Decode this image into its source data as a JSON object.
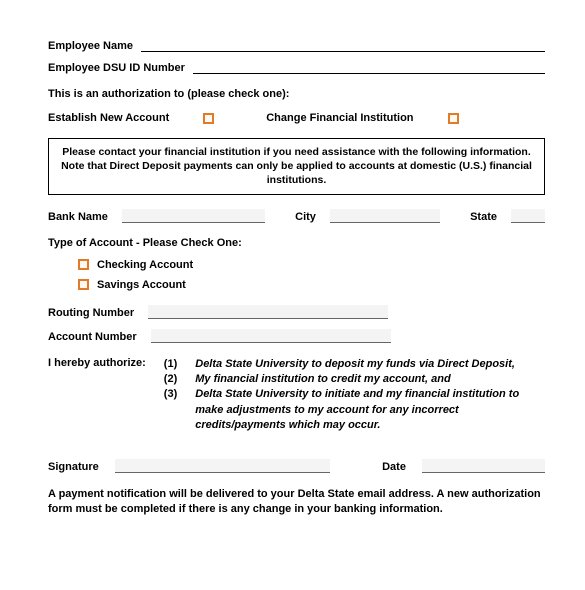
{
  "fields": {
    "employee_name_label": "Employee Name",
    "employee_id_label": "Employee DSU ID Number",
    "auth_prompt": "This is an authorization to (please check one):",
    "establish_label": "Establish New Account",
    "change_label": "Change Financial Institution",
    "notice": "Please contact your financial institution if you need assistance with the following information.  Note that Direct Deposit payments can only be applied to accounts at domestic (U.S.) financial institutions.",
    "bank_label": "Bank Name",
    "city_label": "City",
    "state_label": "State",
    "acct_type_label": "Type of Account - Please Check One:",
    "checking_label": "Checking Account",
    "savings_label": "Savings Account",
    "routing_label": "Routing Number",
    "account_label": "Account Number",
    "authorize_label": "I hereby authorize:",
    "auth_items": {
      "n1": "(1)",
      "n2": "(2)",
      "n3": "(3)",
      "t1": "Delta State University to deposit my funds via Direct Deposit,",
      "t2": "My financial institution to credit my account, and",
      "t3": "Delta State University to initiate and my financial institution to make adjustments to my account for any incorrect credits/payments which may occur."
    },
    "signature_label": "Signature",
    "date_label": "Date",
    "footer": "A payment notification will be delivered to your Delta State email address.  A new authorization form must be completed if there is any change in your banking information."
  }
}
